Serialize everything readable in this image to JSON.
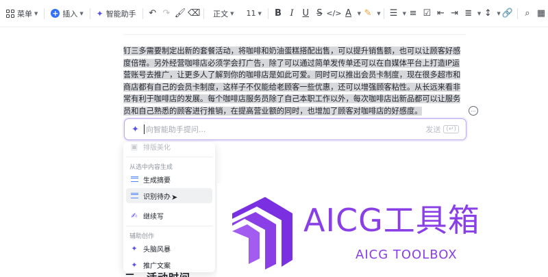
{
  "toolbar": {
    "menu_label": "菜单",
    "insert_label": "插入",
    "ai_assistant_label": "智能助手",
    "text_style": "正文",
    "font_size": "11"
  },
  "document": {
    "paragraph": "钉三多需要制定出新的套餐活动，将咖啡和奶油蛋糕搭配出售，可以提升销售额，也可以让顾客好感度倍增。另外经营咖啡店必须学会打广告，除了可以通过简单发传单还可以在自媒体平台上打造IP运营账号去推广，让更多人了解到你的咖啡店是如此可爱。同时可以推出会员卡制度，现在很多超市和商店都有自己的会员卡制度，这样子不仅能给老顾客一些优惠，还可以增强顾客粘性。从长远来看非常有利于咖啡店的发展。每个咖啡店服务员除了自己本职工作以外，每次咖啡店出新品都可以让服务员和自己熟悉的顾客进行推销，在提高营业额的同时，也增加了顾客对咖啡店的好感度。",
    "heading_partial": "二、活动时间"
  },
  "ai_input": {
    "placeholder": "向智能助手提问...",
    "send_label": "发送",
    "enter_glyph": "(↵)"
  },
  "menu": {
    "top_item": "排版美化",
    "group1_label": "从选中内容生成",
    "items_group1": [
      "生成摘要",
      "识别待办",
      "继续写"
    ],
    "group2_label": "辅助创作",
    "items_group2": [
      "头脑风暴",
      "推广文案"
    ]
  },
  "brand": {
    "title": "AICG工具箱",
    "subtitle": "AICG TOOLBOX",
    "color": "#8a3ee6"
  },
  "colors": {
    "accent": "#3370ff",
    "ai_purple": "#5b53e8",
    "selection": "#d6d8dc"
  }
}
